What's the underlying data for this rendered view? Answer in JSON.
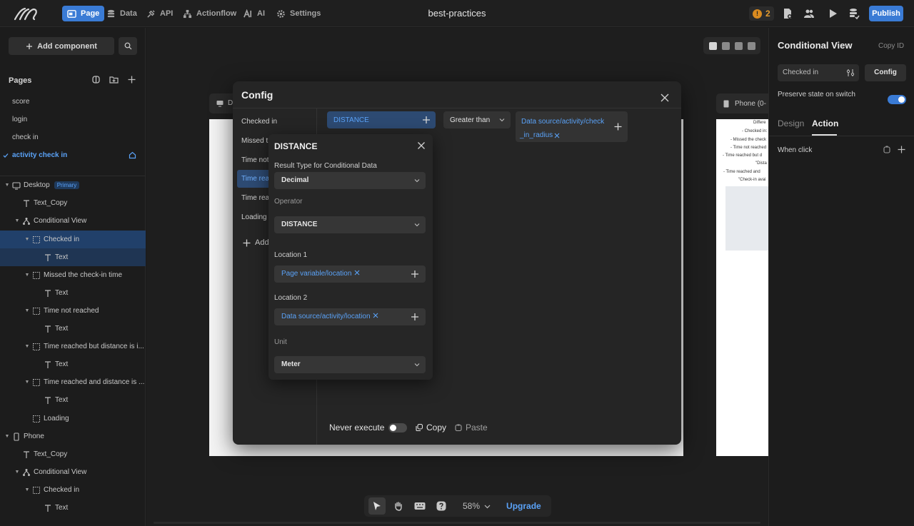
{
  "topbar": {
    "nav": [
      {
        "label": "Page",
        "icon": "page-icon"
      },
      {
        "label": "Data",
        "icon": "database-icon"
      },
      {
        "label": "API",
        "icon": "api-icon"
      },
      {
        "label": "Actionflow",
        "icon": "flow-icon"
      },
      {
        "label": "AI",
        "icon": "ai-icon"
      },
      {
        "label": "Settings",
        "icon": "gear-icon"
      }
    ],
    "title": "best-practices",
    "warning_count": "2",
    "publish_label": "Publish"
  },
  "leftbar": {
    "add_component_label": "Add component",
    "pages_heading": "Pages",
    "pages": [
      "score",
      "login",
      "check in",
      "activity check in"
    ],
    "tree": {
      "desktop": "Desktop",
      "primary_badge": "Primary",
      "text_copy": "Text_Copy",
      "conditional_view": "Conditional View",
      "checked_in": "Checked in",
      "text": "Text",
      "missed": "Missed the check-in time",
      "time_not_reached": "Time not reached",
      "time_reached_but": "Time reached but distance is i...",
      "time_reached_and": "Time reached and distance is ...",
      "loading": "Loading",
      "phone": "Phone"
    }
  },
  "canvas": {
    "phone_label": "Phone (0-",
    "desktop_label": "D",
    "phone_lines": [
      "Differe",
      "- Checked in:",
      "- Missed the check",
      "- Time not reached",
      "- Time reached but d",
      "\"Dista",
      "- Time reached and",
      "\"Check-in avai"
    ],
    "zoom": "58%",
    "upgrade_label": "Upgrade"
  },
  "modal": {
    "title": "Config",
    "conditions": [
      "Checked in",
      "Missed t",
      "Time not",
      "Time rea",
      "Time rea",
      "Loading"
    ],
    "add_label": "Add",
    "left_operand": "DISTANCE",
    "comparator": "Greater than",
    "right_operand_line1": "Data source/activity/check",
    "right_operand_line2": "_in_radius",
    "never_execute_label": "Never execute",
    "copy_label": "Copy",
    "paste_label": "Paste"
  },
  "popover": {
    "title": "DISTANCE",
    "result_type_label": "Result Type for Conditional Data",
    "result_type_value": "Decimal",
    "operator_label": "Operator",
    "operator_value": "DISTANCE",
    "location1_label": "Location 1",
    "location1_value": "Page variable/location",
    "location2_label": "Location 2",
    "location2_value": "Data source/activity/location",
    "unit_label": "Unit",
    "unit_value": "Meter"
  },
  "rightbar": {
    "title": "Conditional View",
    "copy_id_label": "Copy ID",
    "state_select": "Checked in",
    "config_label": "Config",
    "preserve_label": "Preserve state on switch",
    "tab_design": "Design",
    "tab_action": "Action",
    "when_click_label": "When click"
  },
  "colors": {
    "accent": "#3a7bd5",
    "link": "#5aa2f7",
    "warning": "#d98a1f"
  }
}
